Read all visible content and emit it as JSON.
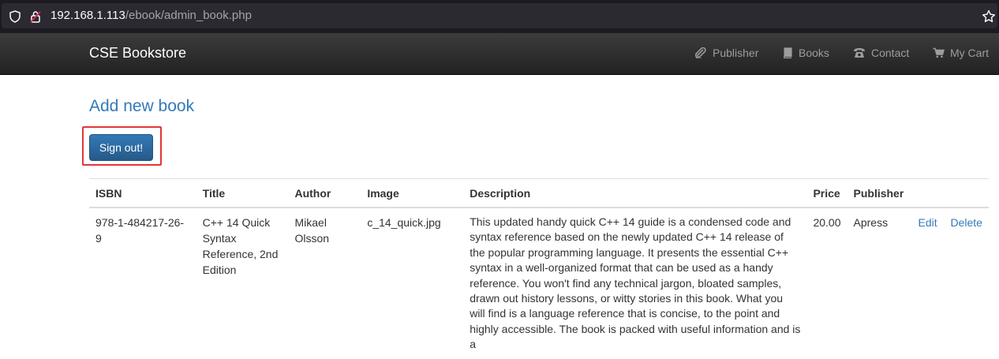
{
  "browser": {
    "url_host": "192.168.1.113",
    "url_path": "/ebook/admin_book.php"
  },
  "navbar": {
    "brand": "CSE Bookstore",
    "items": [
      {
        "label": "Publisher",
        "icon": "paperclip-icon"
      },
      {
        "label": "Books",
        "icon": "book-icon"
      },
      {
        "label": "Contact",
        "icon": "phone-icon"
      },
      {
        "label": "My Cart",
        "icon": "cart-icon"
      }
    ]
  },
  "page": {
    "add_link": "Add new book",
    "signout_label": "Sign out!"
  },
  "table": {
    "headers": [
      "ISBN",
      "Title",
      "Author",
      "Image",
      "Description",
      "Price",
      "Publisher",
      ""
    ],
    "rows": [
      {
        "isbn": "978-1-484217-26-9",
        "title": "C++ 14 Quick Syntax Reference, 2nd Edition",
        "author": "Mikael Olsson",
        "image": "c_14_quick.jpg",
        "description": "This updated handy quick C++ 14 guide is a condensed code and syntax reference based on the newly updated C++ 14 release of the popular programming language. It presents the essential C++ syntax in a well-organized format that can be used as a handy reference. You won't find any technical jargon, bloated samples, drawn out history lessons, or witty stories in this book. What you will find is a language reference that is concise, to the point and highly accessible. The book is packed with useful information and is a",
        "price": "20.00",
        "publisher": "Apress",
        "edit": "Edit",
        "delete": "Delete"
      }
    ]
  },
  "colors": {
    "link": "#337ab7",
    "button": "#337ab7",
    "highlight": "#e3363b",
    "navbar": "#222222"
  }
}
